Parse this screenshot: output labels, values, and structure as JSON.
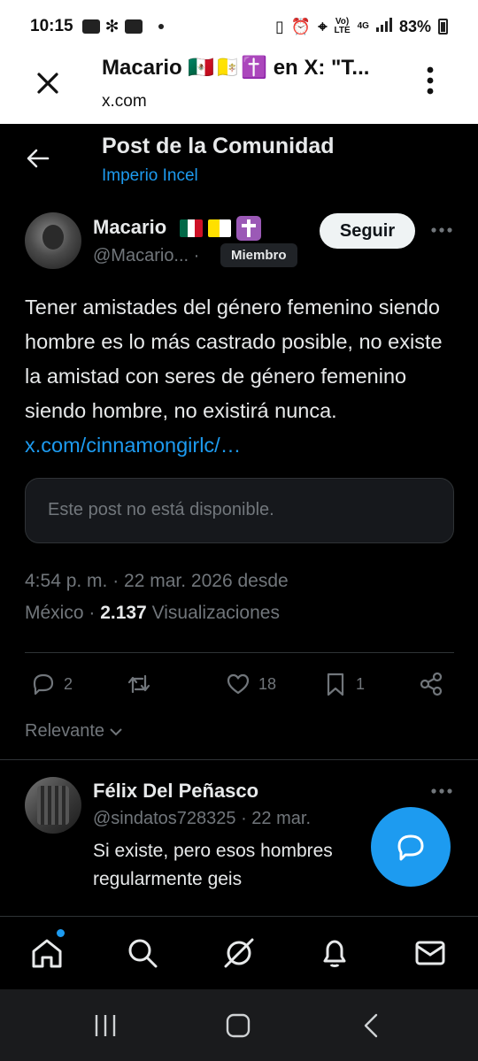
{
  "status_bar": {
    "time": "10:15",
    "network_top": "Vo)",
    "network_bottom": "LTE",
    "gen": "4G",
    "battery": "83%"
  },
  "browser": {
    "title": "Macario 🇲🇽🇻🇦✝️ en X: \"T...",
    "url": "x.com"
  },
  "header": {
    "title": "Post de la Comunidad",
    "community": "Imperio Incel"
  },
  "post": {
    "author_name": "Macario",
    "author_handle": "@Macario...",
    "dot": "·",
    "member_badge": "Miembro",
    "follow_label": "Seguir",
    "text": "Tener amistades del género femenino siendo hombre es lo más castrado posible, no existe la amistad con seres de género femenino siendo hombre, no existirá nunca.",
    "link": "x.com/cinnamongirlc/…",
    "unavailable": "Este post no está disponible.",
    "meta_line1": "4:54 p. m. · 22 mar. 2026 desde",
    "meta_place": "México · ",
    "views_count": "2.137",
    "views_label": "Visualizaciones",
    "replies": "2",
    "likes": "18",
    "bookmarks": "1"
  },
  "sort": {
    "label": "Relevante"
  },
  "reply": {
    "name": "Félix Del Peñasco",
    "handle_date": "@sindatos728325 · 22 mar.",
    "text": "Si existe, pero esos hombres regularmente geis"
  },
  "icons": {
    "close": "close-icon",
    "back": "arrow-left-icon",
    "more": "more-horizontal-icon",
    "reply": "reply-icon",
    "repost": "repost-icon",
    "like": "heart-icon",
    "bookmark": "bookmark-icon",
    "share": "share-icon",
    "compose": "compose-reply-icon",
    "home": "home-icon",
    "search": "search-icon",
    "grok": "grok-icon",
    "notifications": "bell-icon",
    "messages": "mail-icon"
  },
  "colors": {
    "accent": "#1d9bf0",
    "background": "#000000",
    "muted": "#71767b"
  }
}
